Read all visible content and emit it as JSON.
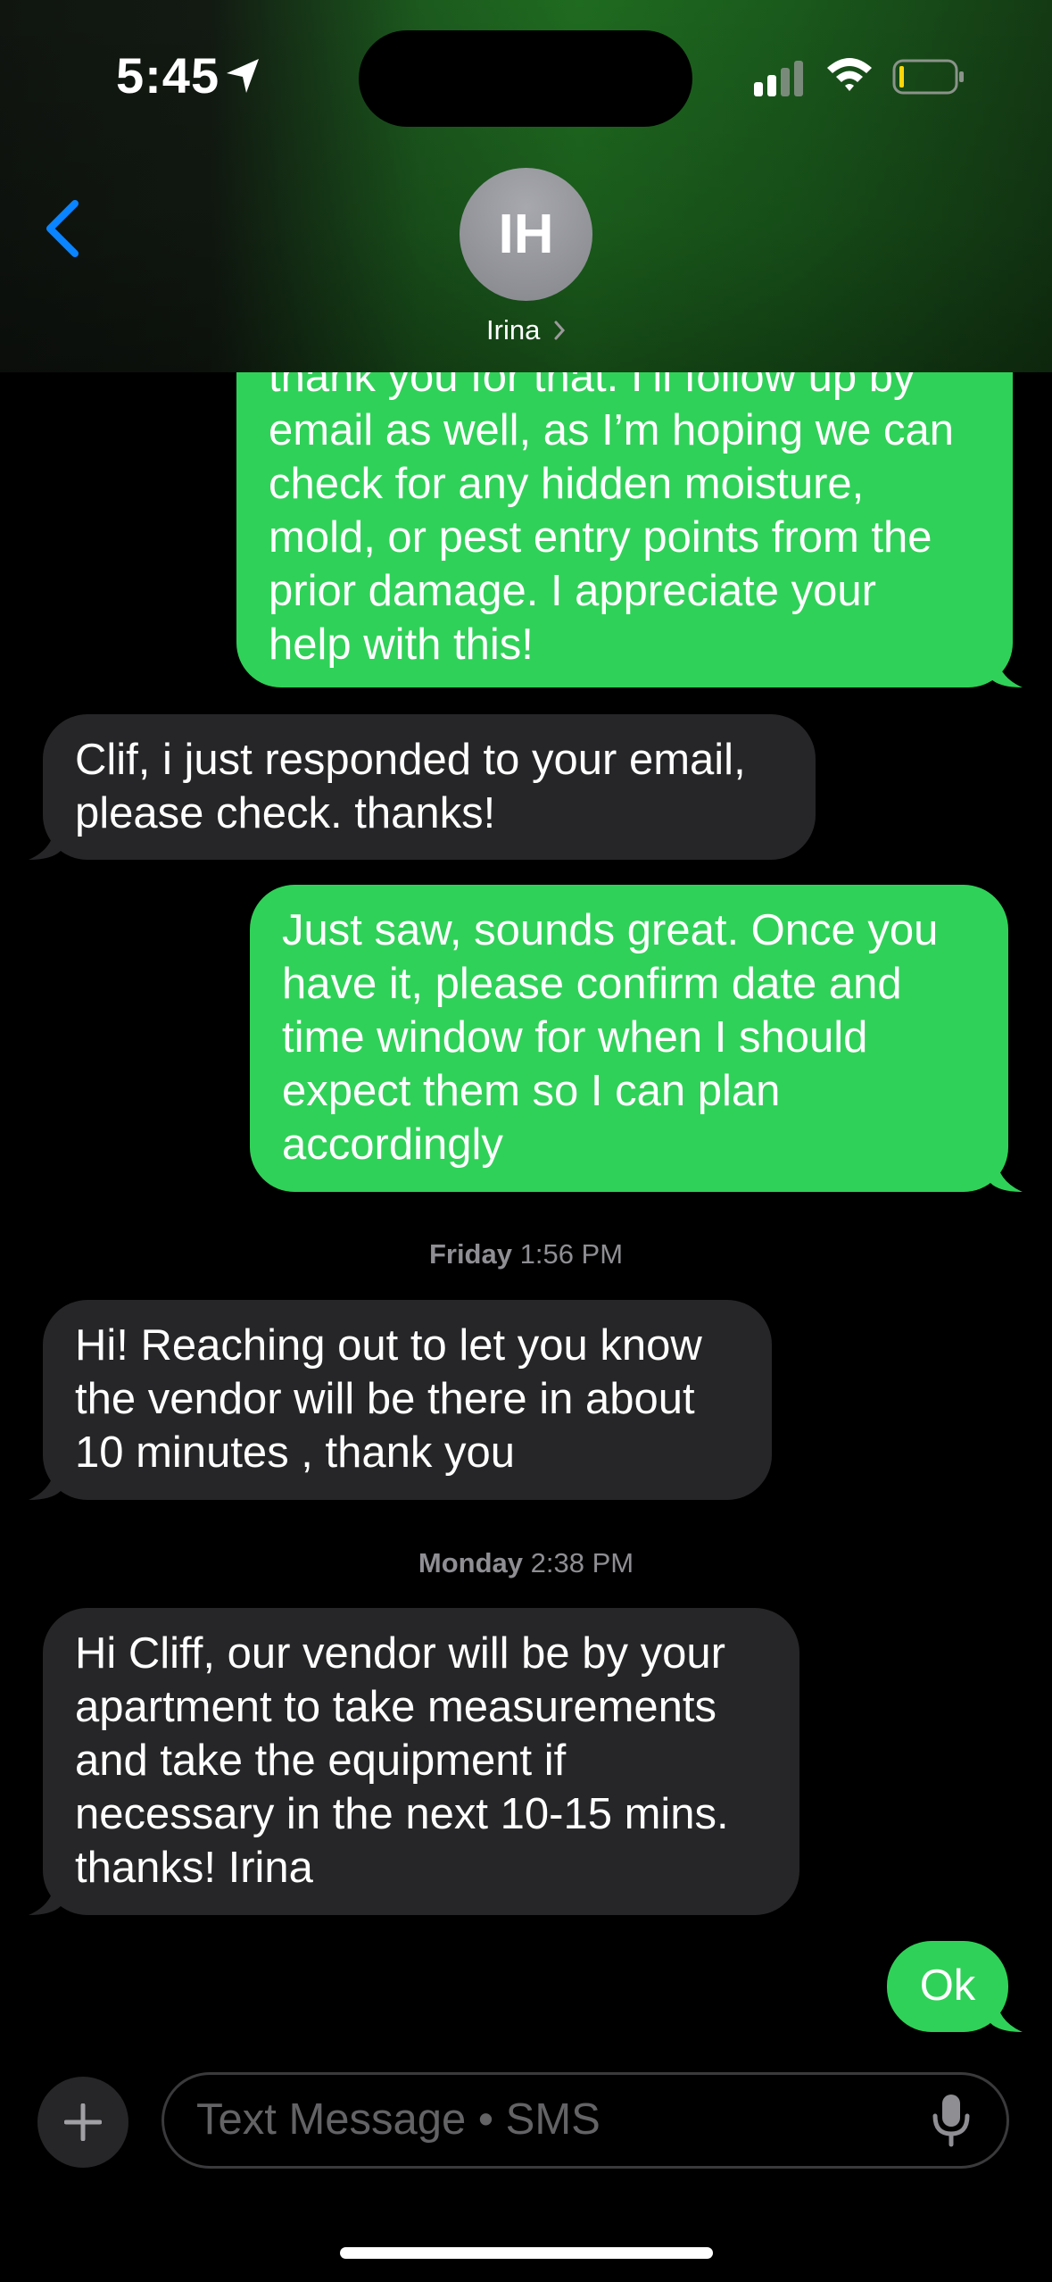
{
  "status_bar": {
    "time": "5:45"
  },
  "header": {
    "avatar_initials": "IH",
    "contact_name": "Irina"
  },
  "messages": [
    {
      "dir": "out",
      "text": "thank you for that. I’ll follow up by\nemail as well, as I’m hoping we can\ncheck for any hidden moisture,\nmold, or pest entry points from the\nprior damage. I appreciate your\nhelp with this!"
    },
    {
      "dir": "in",
      "text": "Clif, i just responded to your email,\nplease check. thanks!"
    },
    {
      "dir": "out",
      "text": "Just saw, sounds great. Once you\nhave it, please confirm date and\ntime window for when I should\nexpect them so I can plan\naccordingly"
    },
    {
      "dir": "in",
      "text": "Hi! Reaching out to let you know\nthe vendor will be there in about\n10 minutes , thank you"
    },
    {
      "dir": "in",
      "text": "Hi Cliff, our vendor will be by your\napartment to take measurements\nand take the equipment if\nnecessary in the next 10-15 mins.\nthanks! Irina"
    },
    {
      "dir": "out",
      "text": "Ok"
    }
  ],
  "timestamps": [
    {
      "day": "Friday",
      "time": "1:56 PM"
    },
    {
      "day": "Monday",
      "time": "2:38 PM"
    }
  ],
  "composer": {
    "placeholder": "Text Message • SMS"
  },
  "colors": {
    "outgoing": "#30d158",
    "incoming": "#262628",
    "accent": "#0a84ff"
  }
}
